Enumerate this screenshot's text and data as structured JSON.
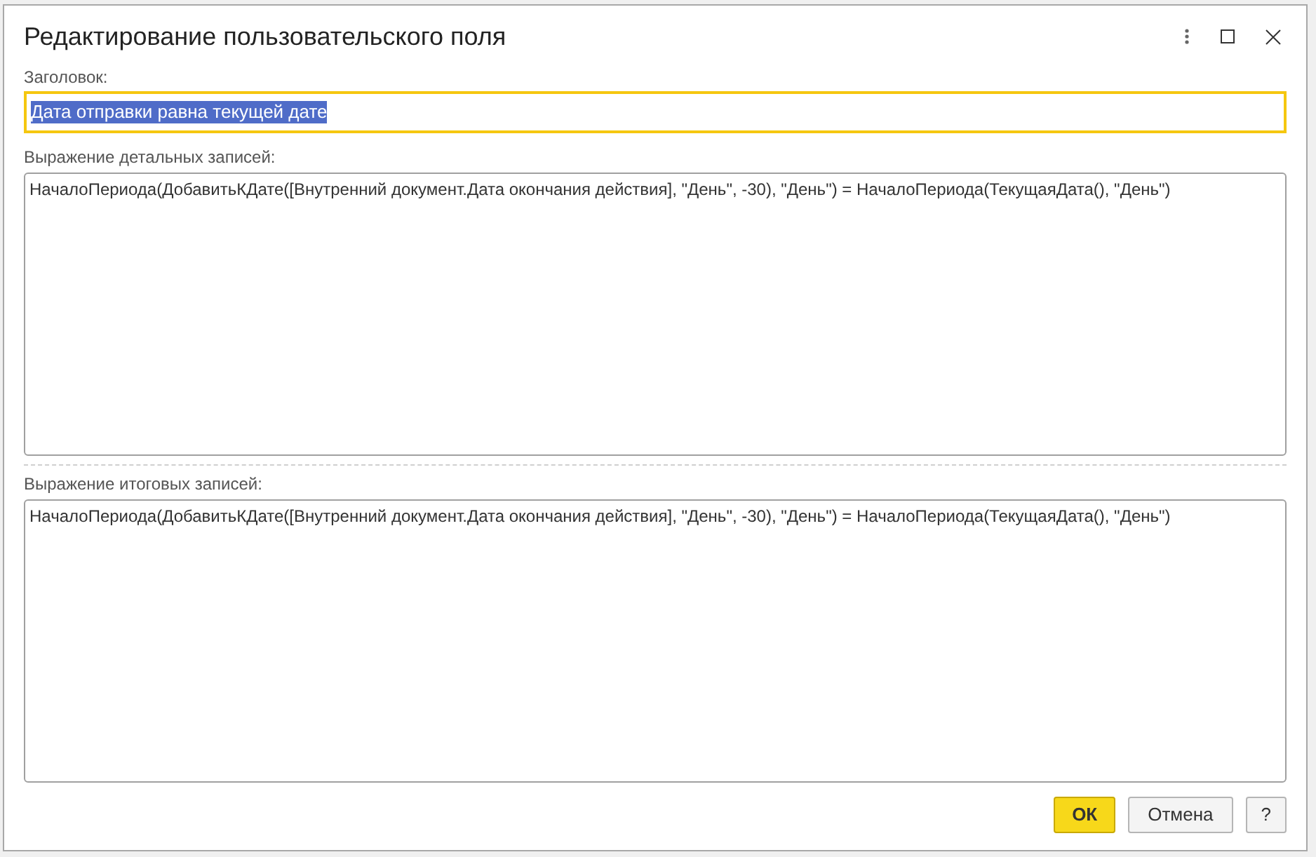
{
  "window": {
    "title": "Редактирование пользовательского поля"
  },
  "caption_field": {
    "label": "Заголовок:",
    "value": "Дата отправки равна текущей дате",
    "focused": true,
    "text_selected": true
  },
  "detail_expression": {
    "label": "Выражение детальных записей:",
    "value": "НачалоПериода(ДобавитьКДате([Внутренний документ.Дата окончания действия], \"День\", -30), \"День\") = НачалоПериода(ТекущаяДата(), \"День\")"
  },
  "total_expression": {
    "label": "Выражение итоговых записей:",
    "value": "НачалоПериода(ДобавитьКДате([Внутренний документ.Дата окончания действия], \"День\", -30), \"День\") = НачалоПериода(ТекущаяДата(), \"День\")"
  },
  "buttons": [
    {
      "label": "ОК",
      "kind": "primary"
    },
    {
      "label": "Отмена",
      "kind": "secondary"
    },
    {
      "label": "?",
      "kind": "help"
    }
  ]
}
